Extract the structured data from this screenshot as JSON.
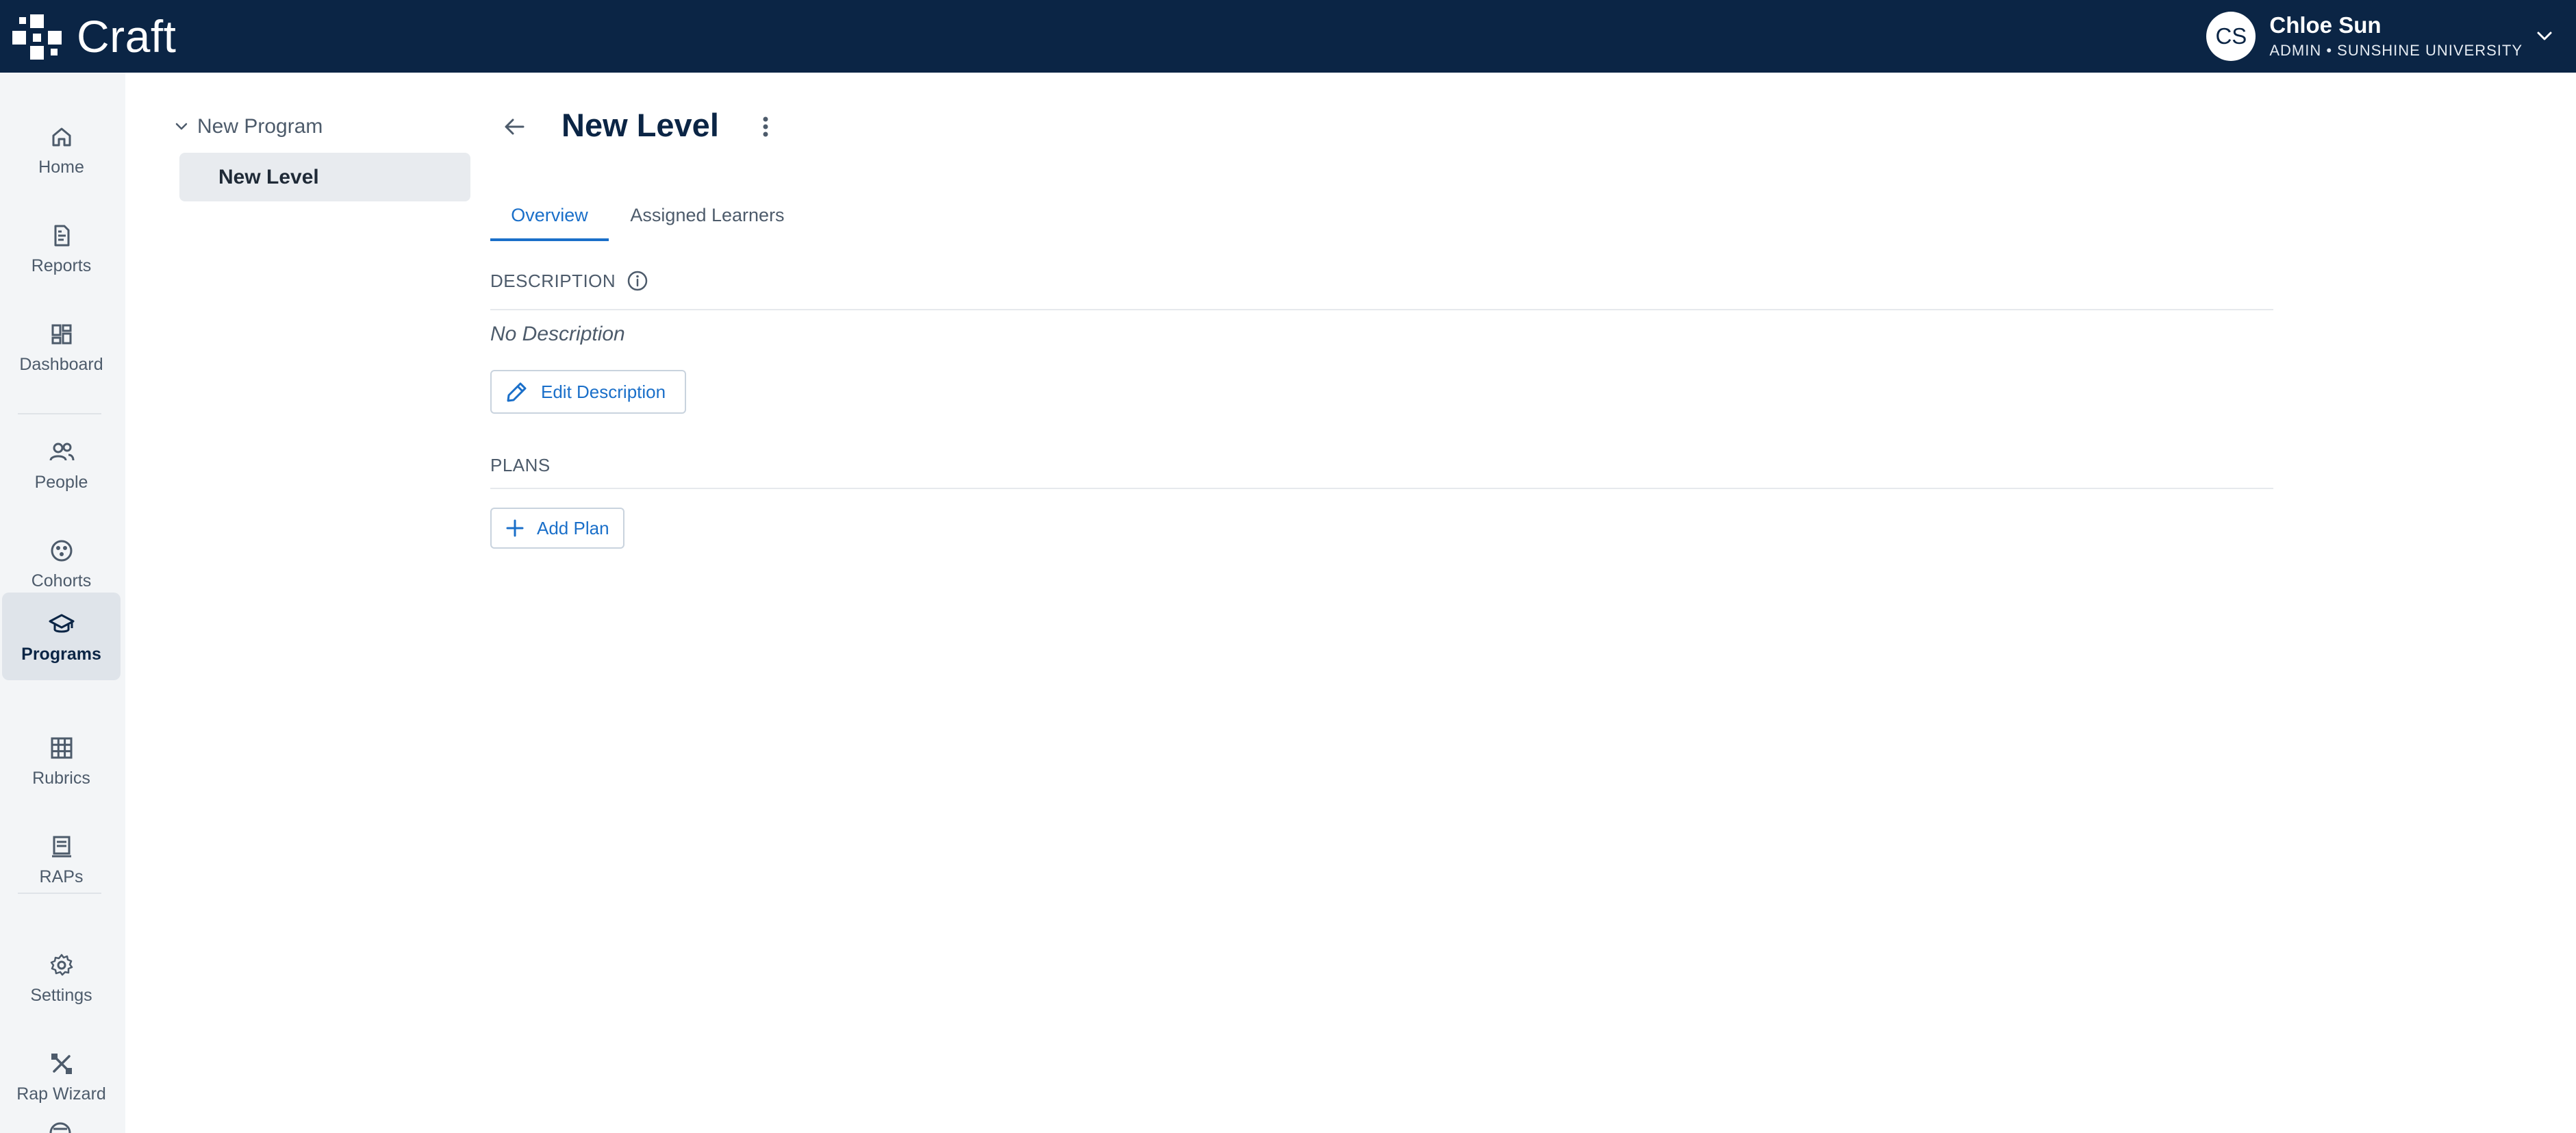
{
  "topbar": {
    "brand": "Craft",
    "user": {
      "initials": "CS",
      "name": "Chloe Sun",
      "role": "ADMIN • SUNSHINE UNIVERSITY"
    }
  },
  "nav": {
    "items": [
      {
        "label": "Home",
        "icon": "home-icon"
      },
      {
        "label": "Reports",
        "icon": "reports-icon"
      },
      {
        "label": "Dashboard",
        "icon": "dashboard-icon"
      },
      {
        "label": "People",
        "icon": "people-icon"
      },
      {
        "label": "Cohorts",
        "icon": "cohorts-icon"
      },
      {
        "label": "Programs",
        "icon": "programs-icon",
        "active": true
      },
      {
        "label": "Rubrics",
        "icon": "rubrics-icon"
      },
      {
        "label": "RAPs",
        "icon": "raps-icon"
      },
      {
        "label": "Settings",
        "icon": "settings-icon"
      },
      {
        "label": "Rap Wizard",
        "icon": "rap-wizard-icon"
      }
    ]
  },
  "tree": {
    "root": "New Program",
    "child": "New Level"
  },
  "main": {
    "title": "New Level",
    "tabs": [
      {
        "label": "Overview",
        "active": true
      },
      {
        "label": "Assigned Learners"
      }
    ],
    "description": {
      "heading": "DESCRIPTION",
      "empty_text": "No Description",
      "edit_label": "Edit Description"
    },
    "plans": {
      "heading": "PLANS",
      "add_label": "Add Plan"
    }
  },
  "colors": {
    "topbar": "#0b2545",
    "accent": "#1a6fc9",
    "nav_bg": "#f3f5f7",
    "nav_active": "#dfe4ea"
  }
}
